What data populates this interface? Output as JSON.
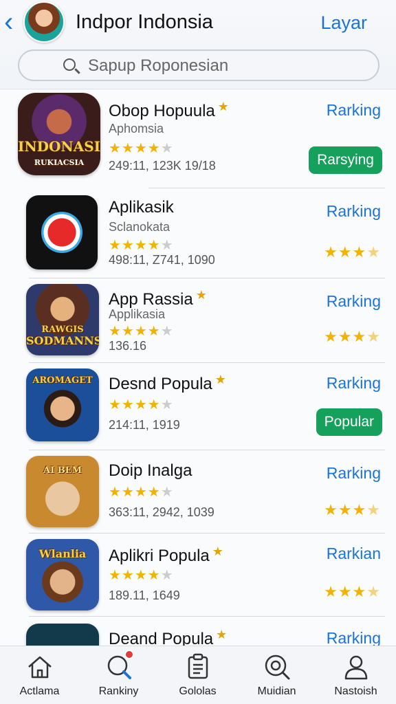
{
  "header": {
    "title": "Indpor Indonsia",
    "action_label": "Layar",
    "back_icon": "chevron-left-icon",
    "accent_color": "#1a73d9"
  },
  "search": {
    "placeholder": "Sapup Roponesian"
  },
  "apps": [
    {
      "name": "Obop Hopuula",
      "starred": true,
      "subtitle": "Aphomsia",
      "icon_title": "INDONASIA",
      "icon_subtitle": "RUKIACSIA",
      "rating_stars": 4.5,
      "stats": "249:11, 123K 19/18",
      "link": "Rarking",
      "badge": "Rarsying",
      "right_rating": null
    },
    {
      "name": "Aplikasik",
      "starred": false,
      "subtitle": "Sclanokata",
      "icon_title": "",
      "icon_subtitle": "",
      "rating_stars": 4,
      "stats": "498:11, Z741, 1090",
      "link": "Rarking",
      "badge": null,
      "right_rating": 3.5
    },
    {
      "name": "App Rassia",
      "starred": true,
      "subtitle": "Applikasia",
      "icon_title": "SODMANNS",
      "icon_subtitle": "RAWGIS",
      "rating_stars": 4,
      "stats": "136.16",
      "link": "Rarking",
      "badge": null,
      "right_rating": 3.5
    },
    {
      "name": "Desnd Popula",
      "starred": true,
      "subtitle": "",
      "icon_title": "AROMAGET",
      "icon_subtitle": "",
      "rating_stars": 4,
      "stats": "214:11, 1919",
      "link": "Rarking",
      "badge": "Popular",
      "right_rating": null
    },
    {
      "name": "Doip Inalga",
      "starred": false,
      "subtitle": "",
      "icon_title": "AI BEM",
      "icon_subtitle": "",
      "rating_stars": 4,
      "stats": "363:11, 2942, 1039",
      "link": "Rarking",
      "badge": null,
      "right_rating": 3.5
    },
    {
      "name": "Aplikri Popula",
      "starred": true,
      "subtitle": "",
      "icon_title": "Wlanlia",
      "icon_subtitle": "",
      "rating_stars": 4,
      "stats": "189.11, 1649",
      "link": "Rarkian",
      "badge": null,
      "right_rating": 3.5
    },
    {
      "name": "Deand Popula",
      "starred": true,
      "subtitle": "",
      "icon_title": "",
      "icon_subtitle": "",
      "rating_stars": 4,
      "stats": "",
      "link": "Rarking",
      "badge": null,
      "right_rating": null
    }
  ],
  "tabs": [
    {
      "label": "Actlama",
      "icon": "home-icon"
    },
    {
      "label": "Rankiny",
      "icon": "search-ranking-icon",
      "notification": true
    },
    {
      "label": "Gololas",
      "icon": "clipboard-icon"
    },
    {
      "label": "Muidian",
      "icon": "magnifier-icon"
    },
    {
      "label": "Nastoish",
      "icon": "person-icon"
    }
  ],
  "colors": {
    "badge": "#15a05c",
    "star": "#f2b300",
    "link": "#1a73d9"
  }
}
